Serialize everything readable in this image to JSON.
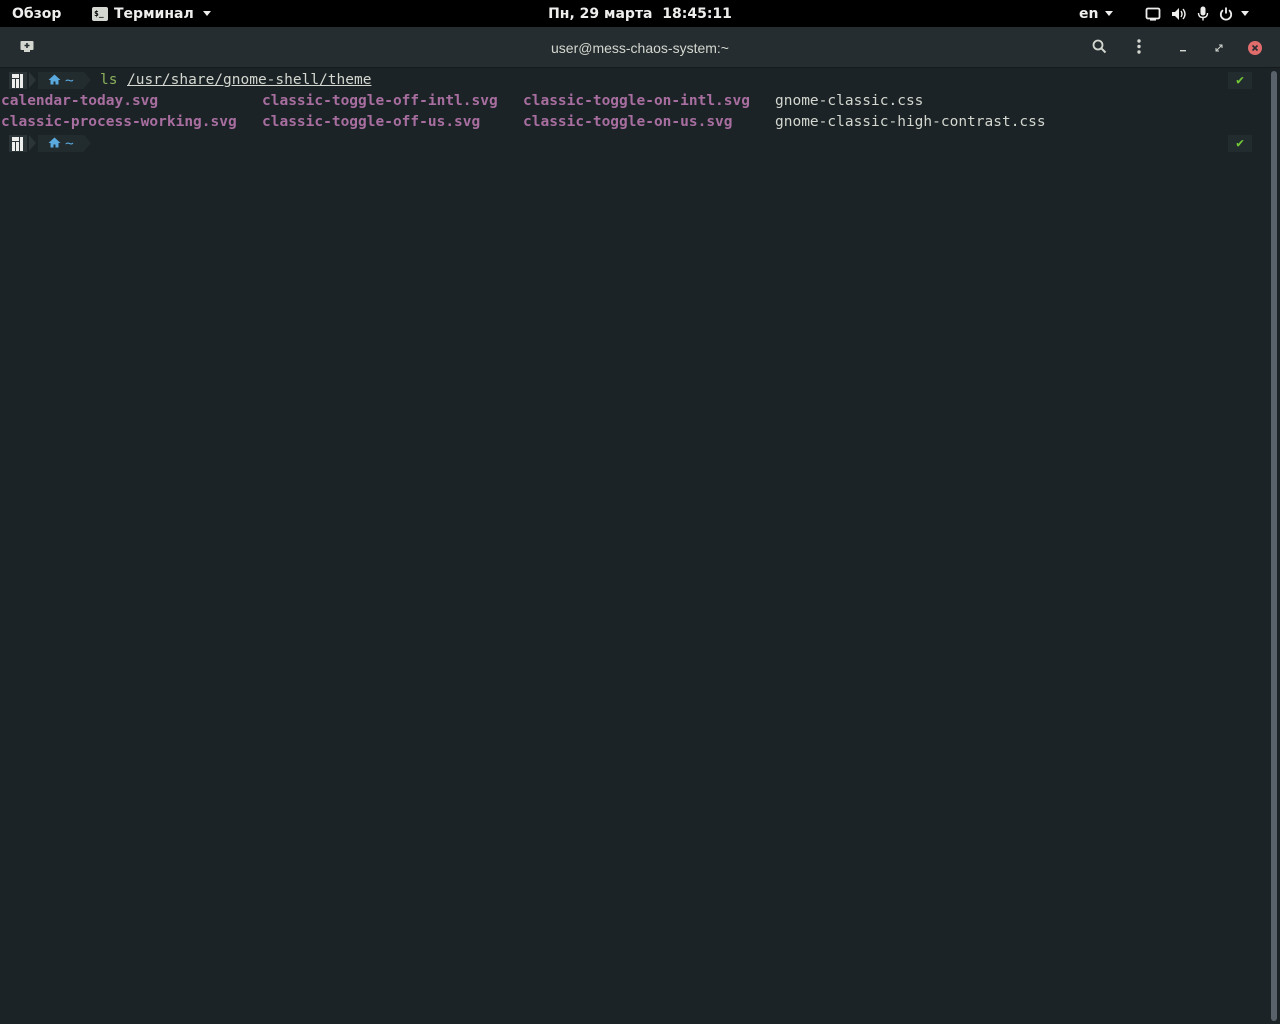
{
  "topbar": {
    "activities": "Обзор",
    "app_menu": "Терминал",
    "clock": "Пн, 29 марта  18:45:11",
    "lang": "en",
    "icons": [
      "screen-icon",
      "volume-icon",
      "microphone-icon",
      "power-icon"
    ]
  },
  "window": {
    "title": "user@mess-chaos-system:~"
  },
  "terminal": {
    "prompt_dir": "~",
    "command": "ls",
    "command_arg": "/usr/share/gnome-shell/theme",
    "status_symbol": "✔",
    "listing": {
      "row1": [
        "calendar-today.svg",
        "classic-toggle-off-intl.svg",
        "classic-toggle-on-intl.svg",
        "gnome-classic.css"
      ],
      "row2": [
        "classic-process-working.svg",
        "classic-toggle-off-us.svg",
        "classic-toggle-on-us.svg",
        "gnome-classic-high-contrast.css"
      ]
    }
  },
  "colors": {
    "background": "#1b2326",
    "svg_files": "#a86ea0",
    "command": "#8bb05c",
    "dir": "#5aaae0",
    "status_ok": "#73c936"
  }
}
